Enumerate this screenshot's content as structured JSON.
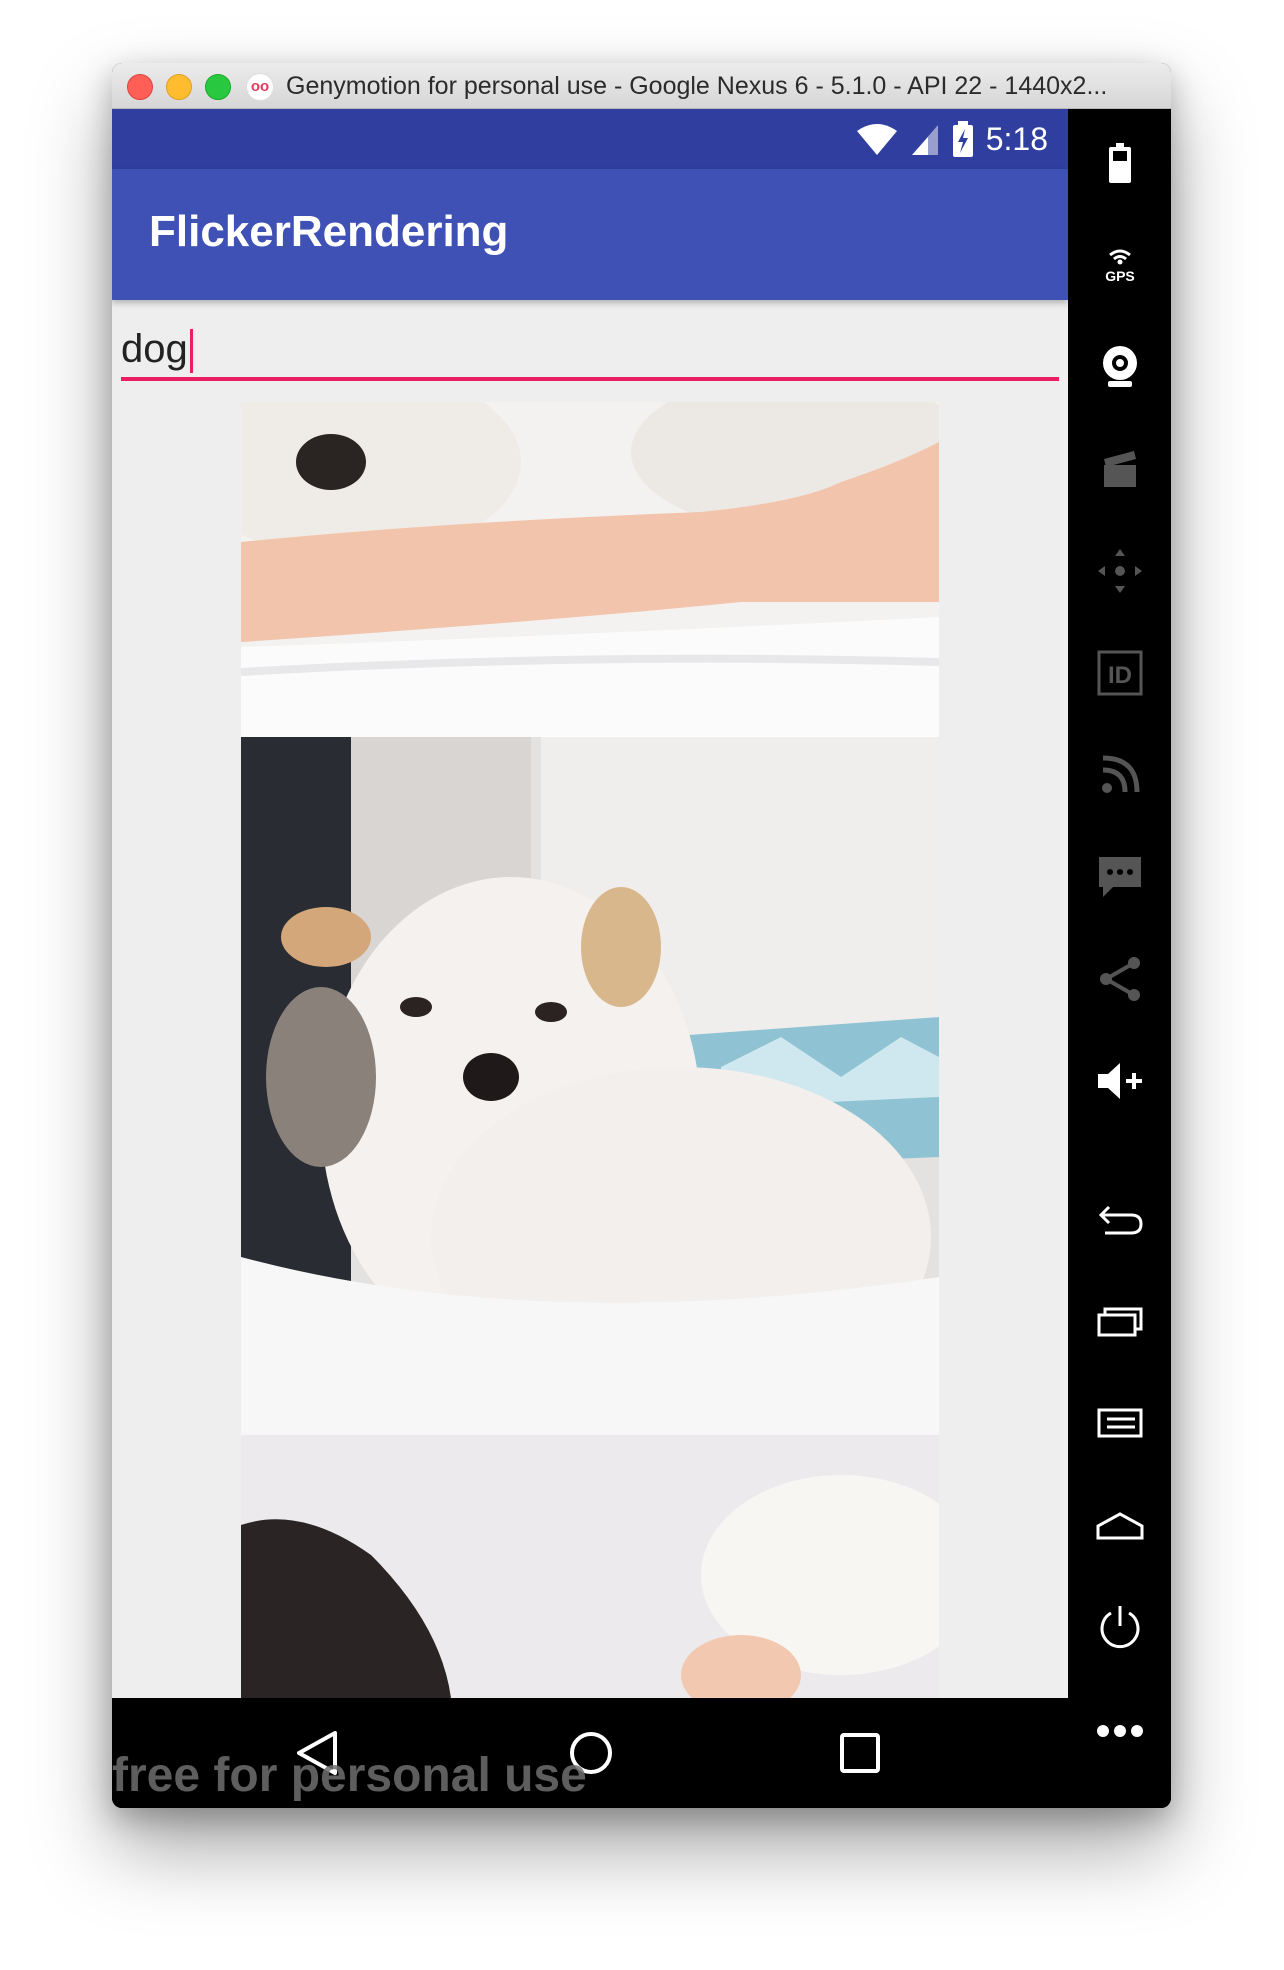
{
  "window": {
    "title": "Genymotion for personal use - Google Nexus 6 - 5.1.0 - API 22 - 1440x2...",
    "app_icon": "oo"
  },
  "statusbar": {
    "time": "5:18"
  },
  "appbar": {
    "title": "FlickerRendering"
  },
  "search": {
    "value": "dog"
  },
  "results": [
    {
      "description": "white dog with arm on bed"
    },
    {
      "description": "white shih tzu dog on bed"
    },
    {
      "description": "dog paws near person"
    }
  ],
  "watermark": "free for personal use",
  "navbar": {
    "icons": [
      "back-icon",
      "home-icon",
      "recents-icon"
    ]
  },
  "sidebar": {
    "icons": [
      "battery-icon",
      "gps-icon",
      "webcam-icon",
      "capture-icon",
      "dpad-icon",
      "id-icon",
      "signal-icon",
      "sms-icon",
      "share-icon",
      "volume-up-icon",
      "back-icon",
      "recents-icon",
      "menu-icon",
      "home-icon",
      "power-icon",
      "more-icon"
    ],
    "gps_label": "GPS",
    "id_label": "ID"
  },
  "colors": {
    "primary_dark": "#303f9f",
    "primary": "#3f51b5",
    "accent": "#e91e63"
  }
}
